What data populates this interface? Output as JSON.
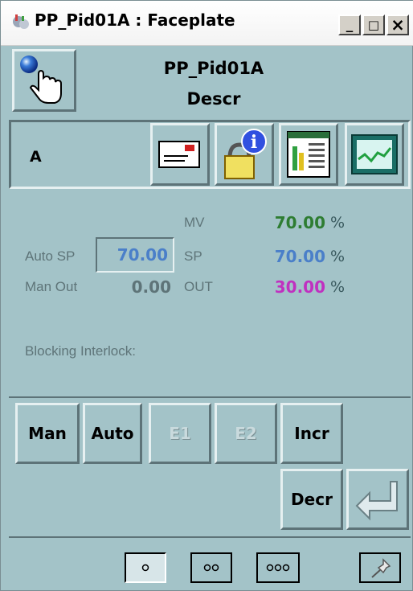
{
  "window": {
    "title": "PP_Pid01A : Faceplate",
    "minimize": "_",
    "maximize": "□",
    "close": "×"
  },
  "header": {
    "tag": "PP_Pid01A",
    "description": "Descr"
  },
  "toolbar": {
    "mode_label": "A",
    "icons": [
      "alarm-message-icon",
      "info-lock-icon",
      "parameter-list-icon",
      "trend-icon"
    ]
  },
  "values": {
    "mv_label": "MV",
    "mv_value": "70.00",
    "mv_unit": "%",
    "auto_sp_label": "Auto SP",
    "auto_sp_value": "70.00",
    "sp_label": "SP",
    "sp_value": "70.00",
    "sp_unit": "%",
    "man_out_label": "Man Out",
    "man_out_value": "0.00",
    "out_label": "OUT",
    "out_value": "30.00",
    "out_unit": "%",
    "blocking_label": "Blocking Interlock:"
  },
  "buttons": {
    "man": "Man",
    "auto": "Auto",
    "e1": "E1",
    "e2": "E2",
    "incr": "Incr",
    "decr": "Decr"
  },
  "colors": {
    "background": "#a3c3c8",
    "mv": "#2e7d32",
    "sp": "#4a7fc9",
    "out": "#c030c0"
  }
}
